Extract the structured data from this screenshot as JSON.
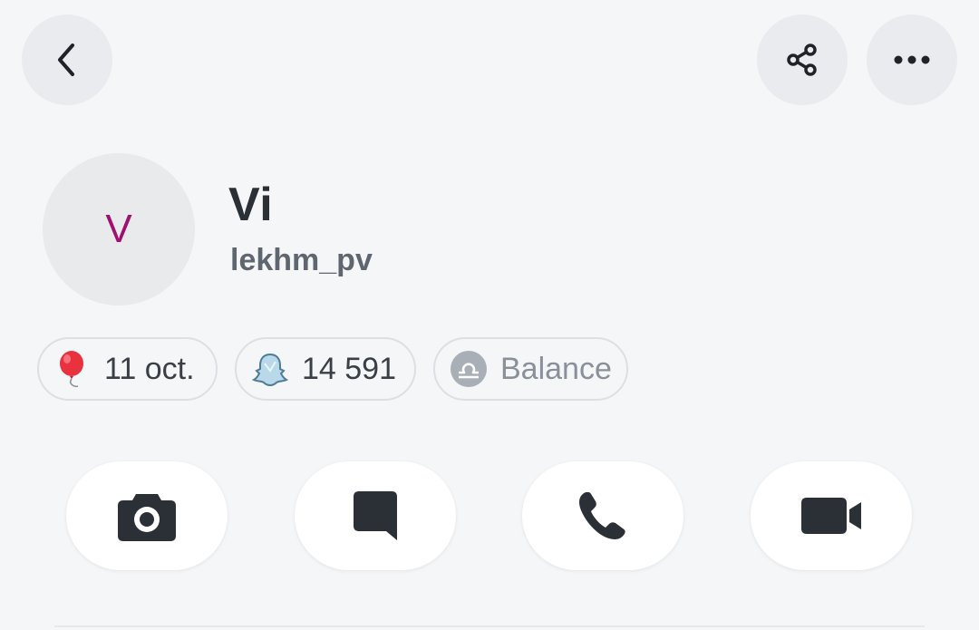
{
  "header": {
    "back_icon": "chevron-left-icon",
    "share_icon": "share-icon",
    "more_icon": "more-horizontal-icon"
  },
  "profile": {
    "avatar_initial": "V",
    "avatar_color": "#a01070",
    "display_name": "Vi",
    "username": "lekhm_pv"
  },
  "chips": {
    "birthday": {
      "icon": "balloon-icon",
      "label": "11 oct."
    },
    "score": {
      "icon": "ghost-icon",
      "label": "14 591"
    },
    "zodiac": {
      "icon": "libra-icon",
      "label": "Balance"
    }
  },
  "actions": [
    {
      "icon": "camera-icon"
    },
    {
      "icon": "chat-icon"
    },
    {
      "icon": "phone-icon"
    },
    {
      "icon": "video-camera-icon"
    }
  ]
}
